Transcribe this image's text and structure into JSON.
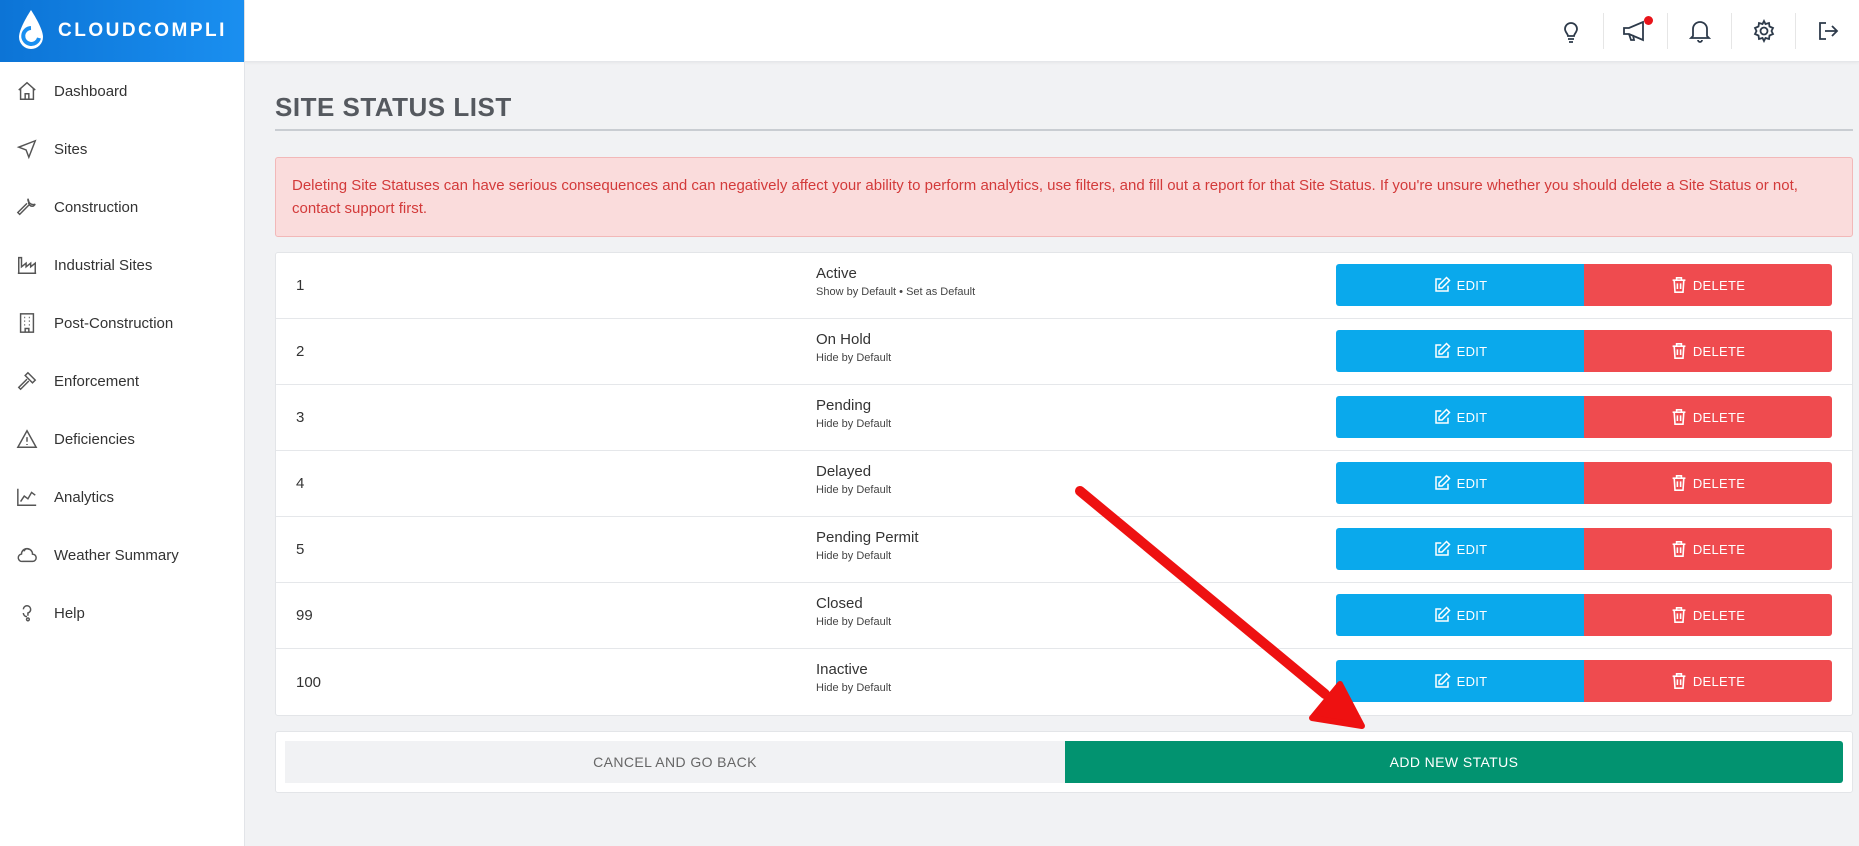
{
  "brand": {
    "name": "CLOUDCOMPLI"
  },
  "sidebar": {
    "items": [
      {
        "label": "Dashboard",
        "icon": "home-icon"
      },
      {
        "label": "Sites",
        "icon": "navigation-icon"
      },
      {
        "label": "Construction",
        "icon": "wrench-icon"
      },
      {
        "label": "Industrial Sites",
        "icon": "factory-icon"
      },
      {
        "label": "Post-Construction",
        "icon": "building-icon"
      },
      {
        "label": "Enforcement",
        "icon": "gavel-icon"
      },
      {
        "label": "Deficiencies",
        "icon": "warning-icon"
      },
      {
        "label": "Analytics",
        "icon": "chart-icon"
      },
      {
        "label": "Weather Summary",
        "icon": "cloud-icon"
      },
      {
        "label": "Help",
        "icon": "help-icon"
      }
    ]
  },
  "topbar": {
    "icons": [
      "lightbulb-icon",
      "megaphone-icon",
      "bell-icon",
      "gear-icon",
      "logout-icon"
    ]
  },
  "page": {
    "title": "SITE STATUS LIST",
    "alert": "Deleting Site Statuses can have serious consequences and can negatively affect your ability to perform analytics, use filters, and fill out a report for that Site Status. If you're unsure whether you should delete a Site Status or not, contact support first.",
    "edit_label": "EDIT",
    "delete_label": "DELETE",
    "cancel_label": "CANCEL AND GO BACK",
    "add_label": "ADD NEW STATUS"
  },
  "statuses": [
    {
      "num": "1",
      "name": "Active",
      "sub": "Show by Default • Set as Default"
    },
    {
      "num": "2",
      "name": "On Hold",
      "sub": "Hide by Default"
    },
    {
      "num": "3",
      "name": "Pending",
      "sub": "Hide by Default"
    },
    {
      "num": "4",
      "name": "Delayed",
      "sub": "Hide by Default"
    },
    {
      "num": "5",
      "name": "Pending Permit",
      "sub": "Hide by Default"
    },
    {
      "num": "99",
      "name": "Closed",
      "sub": "Hide by Default"
    },
    {
      "num": "100",
      "name": "Inactive",
      "sub": "Hide by Default"
    }
  ],
  "colors": {
    "brand": "#0c74d6",
    "edit": "#0aa9ec",
    "delete": "#ef4b4f",
    "add": "#029370",
    "alert_bg": "#fadcdc",
    "alert_text": "#d33a3a",
    "arrow": "#ee1111"
  }
}
